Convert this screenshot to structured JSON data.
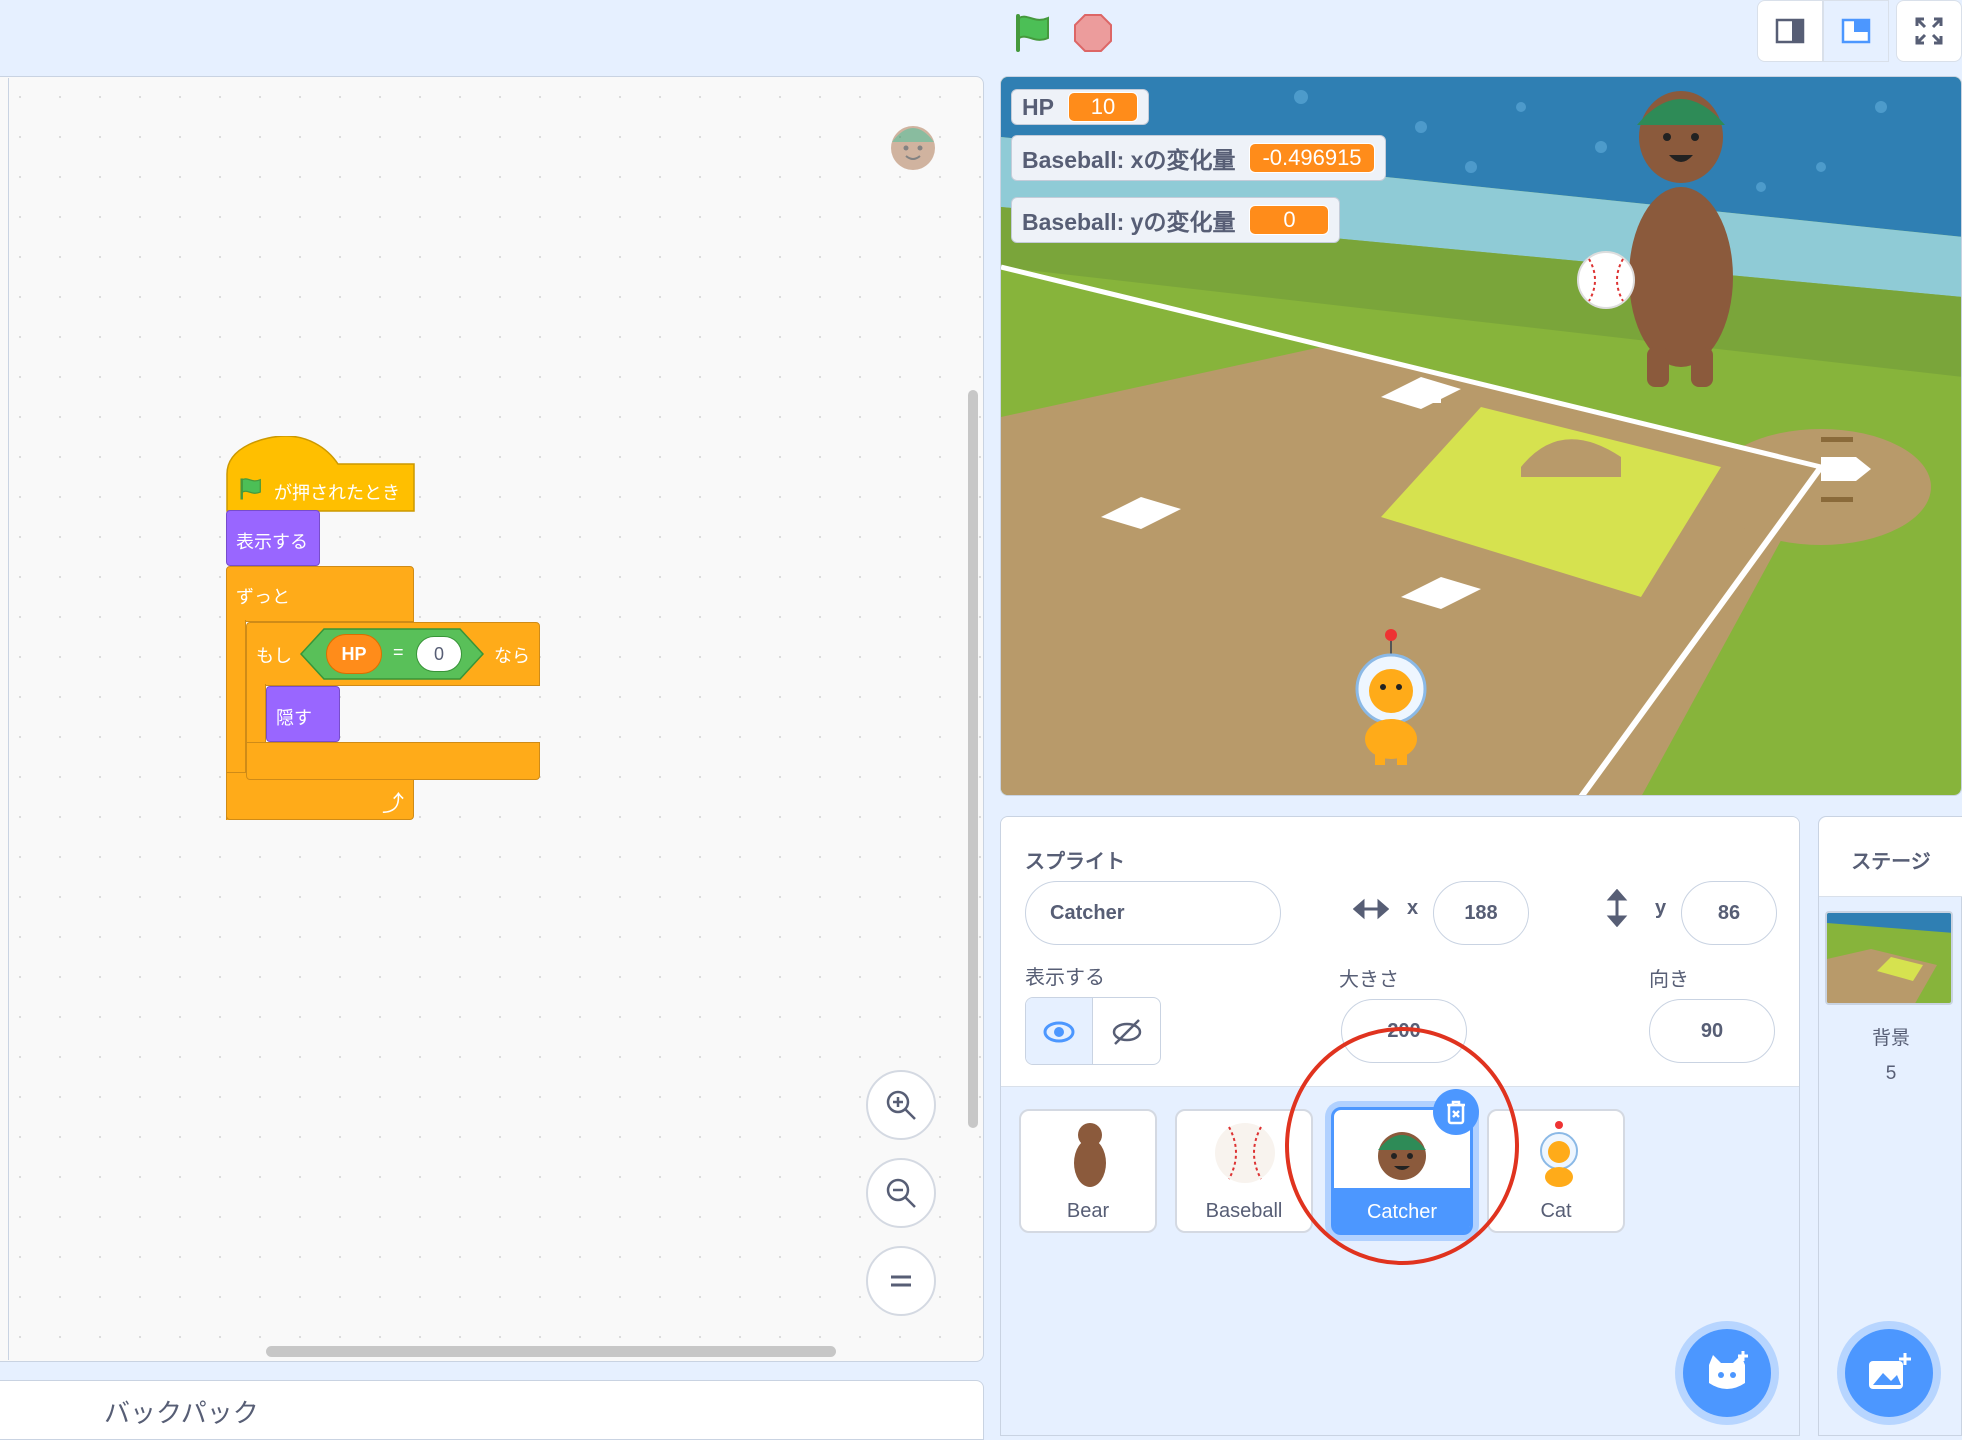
{
  "topbar": {
    "green_flag": "green-flag-icon",
    "stop": "stop-icon",
    "modes": [
      "small-stage-icon",
      "normal-stage-icon",
      "fullscreen-icon"
    ]
  },
  "code": {
    "hat_label": "が押されたとき",
    "show_label": "表示する",
    "forever_label": "ずっと",
    "if_label": "もし",
    "then_label": "なら",
    "variable": "HP",
    "operator": "=",
    "compare_value": "0",
    "hide_label": "隠す",
    "backpack_label": "バックパック"
  },
  "stage": {
    "monitors": [
      {
        "label": "HP",
        "value": "10"
      },
      {
        "label": "Baseball: xの変化量",
        "value": "-0.496915"
      },
      {
        "label": "Baseball: yの変化量",
        "value": "0"
      }
    ]
  },
  "sprite_info": {
    "sprite_label": "スプライト",
    "sprite_name": "Catcher",
    "x_label": "x",
    "x_value": "188",
    "y_label": "y",
    "y_value": "86",
    "show_label": "表示する",
    "size_label": "大きさ",
    "size_value": "200",
    "direction_label": "向き",
    "direction_value": "90"
  },
  "sprites": [
    {
      "name": "Bear"
    },
    {
      "name": "Baseball"
    },
    {
      "name": "Catcher",
      "selected": true
    },
    {
      "name": "Cat"
    }
  ],
  "stage_pane": {
    "title": "ステージ",
    "backdrop_label": "背景",
    "backdrop_count": "5"
  },
  "colors": {
    "accent": "#4c97ff",
    "events": "#ffbf00",
    "looks": "#9966ff",
    "control": "#ffab19",
    "operators": "#59c059",
    "variables": "#ff8c1a",
    "highlight_circle": "#e0331f"
  }
}
